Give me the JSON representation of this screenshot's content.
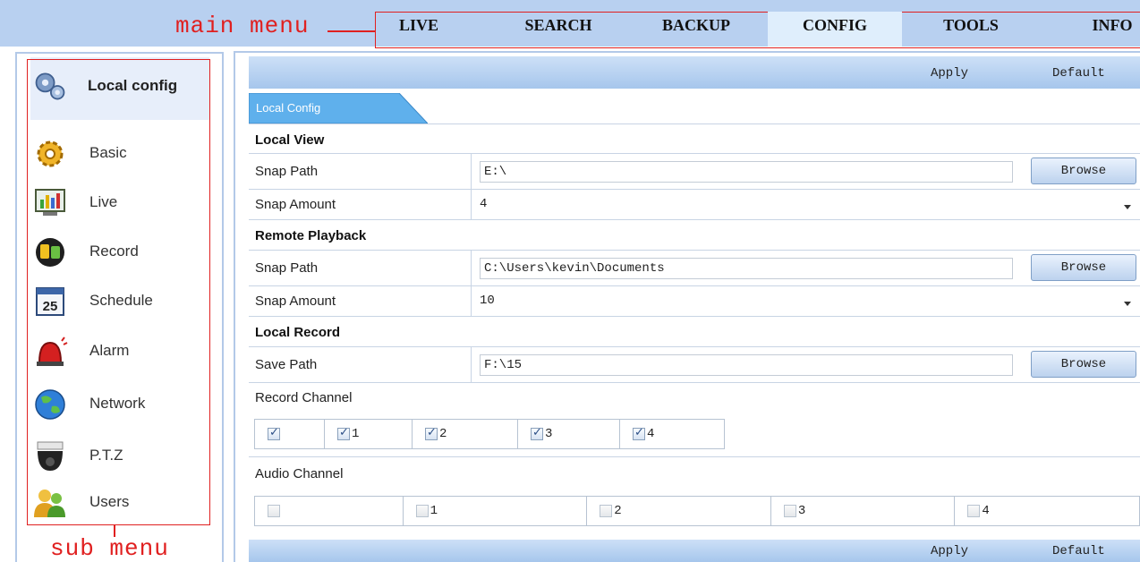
{
  "annotations": {
    "main_menu": "main menu",
    "sub_menu": "sub menu"
  },
  "main_menu": [
    "LIVE",
    "SEARCH",
    "BACKUP",
    "CONFIG",
    "TOOLS",
    "INFO"
  ],
  "main_menu_active": "CONFIG",
  "sidebar": {
    "header": "Local config",
    "items": [
      {
        "label": "Basic",
        "icon": "gear-icon"
      },
      {
        "label": "Live",
        "icon": "live-monitor-icon"
      },
      {
        "label": "Record",
        "icon": "record-icon"
      },
      {
        "label": "Schedule",
        "icon": "calendar-icon"
      },
      {
        "label": "Alarm",
        "icon": "alarm-siren-icon"
      },
      {
        "label": "Network",
        "icon": "globe-icon"
      },
      {
        "label": "P.T.Z",
        "icon": "dome-camera-icon"
      },
      {
        "label": "Users",
        "icon": "users-icon"
      }
    ],
    "calendar_day": "25"
  },
  "toolbar": {
    "apply": "Apply",
    "default": "Default"
  },
  "tab": "Local Config",
  "local_view": {
    "title": "Local View",
    "snap_path_label": "Snap Path",
    "snap_path_value": "E:\\",
    "snap_amount_label": "Snap Amount",
    "snap_amount_value": "4",
    "browse": "Browse"
  },
  "remote_playback": {
    "title": "Remote Playback",
    "snap_path_label": "Snap Path",
    "snap_path_value": "C:\\Users\\kevin\\Documents",
    "snap_amount_label": "Snap Amount",
    "snap_amount_value": "10",
    "browse": "Browse"
  },
  "local_record": {
    "title": "Local Record",
    "save_path_label": "Save Path",
    "save_path_value": "F:\\15",
    "browse": "Browse",
    "record_channel_label": "Record Channel",
    "record_channels": [
      {
        "label": "",
        "checked": true
      },
      {
        "label": "1",
        "checked": true
      },
      {
        "label": "2",
        "checked": true
      },
      {
        "label": "3",
        "checked": true
      },
      {
        "label": "4",
        "checked": true
      }
    ],
    "audio_channel_label": "Audio Channel",
    "audio_channels": [
      {
        "label": "",
        "checked": false
      },
      {
        "label": "1",
        "checked": false
      },
      {
        "label": "2",
        "checked": false
      },
      {
        "label": "3",
        "checked": false
      },
      {
        "label": "4",
        "checked": false
      }
    ]
  },
  "colors": {
    "annotation": "#e02020",
    "tab": "#5fb0ec",
    "menubar": "#b8d0f0"
  }
}
